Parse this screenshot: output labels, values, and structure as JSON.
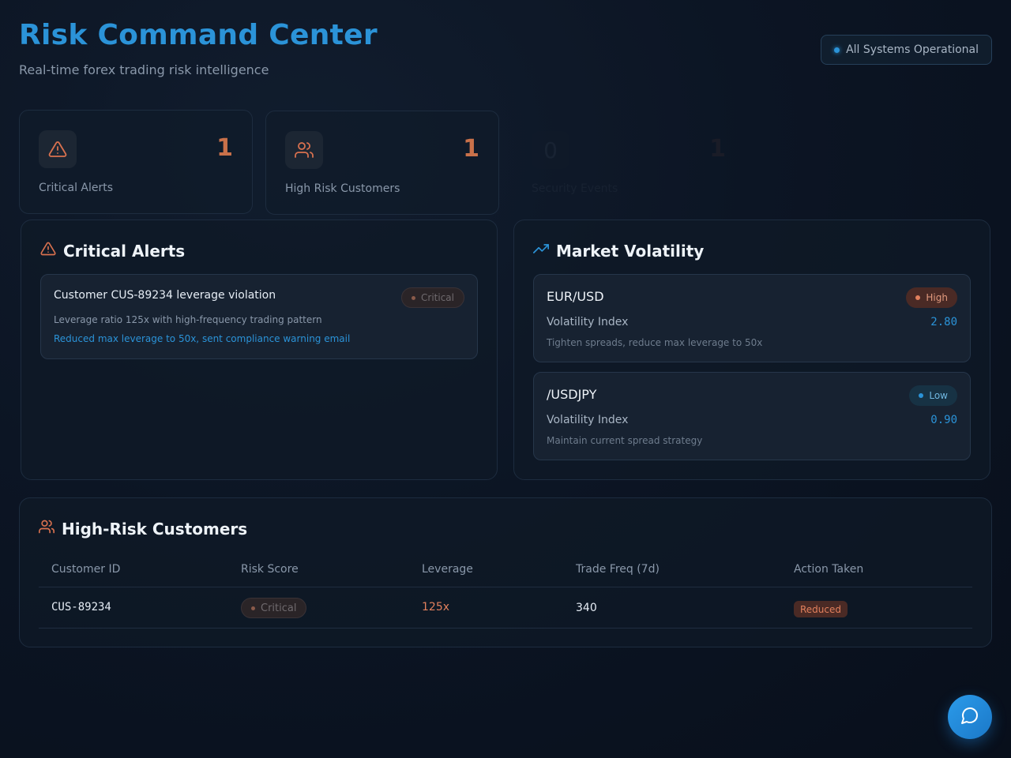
{
  "header": {
    "title": "Risk Command Center",
    "subtitle": "Real-time forex trading risk intelligence",
    "status": "All Systems Operational"
  },
  "stats": [
    {
      "label": "Critical Alerts",
      "value": "1",
      "icon": "alert-triangle-icon"
    },
    {
      "label": "High Risk Customers",
      "value": "1",
      "icon": "users-icon"
    },
    {
      "label": "Security Events",
      "value": "1",
      "icon_value": "0"
    }
  ],
  "alerts_panel": {
    "title": "Critical Alerts",
    "items": [
      {
        "title": "Customer CUS-89234 leverage violation",
        "badge": "Critical",
        "description": "Leverage ratio 125x with high-frequency trading pattern",
        "action": "Reduced max leverage to 50x, sent compliance warning email"
      }
    ]
  },
  "volatility_panel": {
    "title": "Market Volatility",
    "items": [
      {
        "pair": "EUR/USD",
        "level": "High",
        "label": "Volatility Index",
        "value": "2.80",
        "note": "Tighten spreads, reduce max leverage to 50x"
      },
      {
        "pair": "/USDJPY",
        "level": "Low",
        "label": "Volatility Index",
        "value": "0.90",
        "note": "Maintain current spread strategy"
      }
    ]
  },
  "customers_panel": {
    "title": "High-Risk Customers",
    "columns": [
      "Customer ID",
      "Risk Score",
      "Leverage",
      "Trade Freq (7d)",
      "Action Taken"
    ],
    "rows": [
      {
        "customer_id": "CUS-89234",
        "risk_score": "Critical",
        "leverage": "125x",
        "trade_freq": "340",
        "action": "Reduced"
      }
    ]
  },
  "colors": {
    "accent": "#2b93d8",
    "warning": "#c9714a",
    "danger_badge": "#4a2a25"
  }
}
